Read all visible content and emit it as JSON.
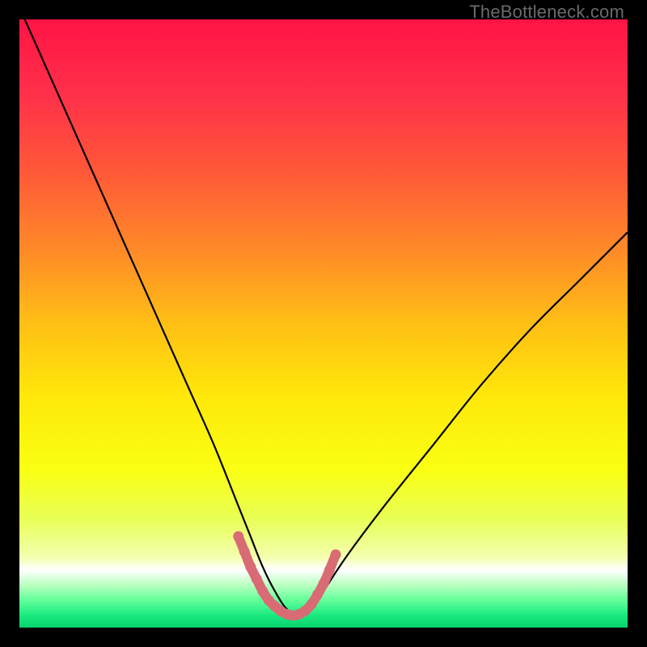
{
  "watermark": "TheBottleneck.com",
  "chart_data": {
    "type": "line",
    "title": "",
    "xlabel": "",
    "ylabel": "",
    "xlim": [
      0,
      100
    ],
    "ylim": [
      0,
      100
    ],
    "grid": false,
    "legend": false,
    "series": [
      {
        "name": "curve",
        "x": [
          0,
          4,
          8,
          12,
          16,
          20,
          24,
          28,
          32,
          36,
          38,
          40,
          42,
          44,
          46,
          48,
          50,
          54,
          60,
          68,
          76,
          84,
          92,
          100
        ],
        "y": [
          102,
          93,
          84,
          75,
          66,
          57,
          48,
          39,
          30,
          20,
          15,
          10,
          6,
          3,
          2,
          3,
          6,
          12,
          20,
          30,
          40,
          49,
          57,
          65
        ]
      },
      {
        "name": "highlight",
        "x": [
          36,
          37,
          38,
          39,
          40,
          41,
          42,
          43,
          44,
          45,
          46,
          47,
          48,
          49,
          50,
          51,
          52
        ],
        "y": [
          15.0,
          12.5,
          10.0,
          8.0,
          6.0,
          4.5,
          3.5,
          2.7,
          2.2,
          2.0,
          2.2,
          2.8,
          3.8,
          5.4,
          7.2,
          9.5,
          12.0
        ]
      }
    ],
    "background_gradient": {
      "stops": [
        {
          "pos": 0.0,
          "color": "#ff1444"
        },
        {
          "pos": 0.12,
          "color": "#ff2f4a"
        },
        {
          "pos": 0.25,
          "color": "#ff5838"
        },
        {
          "pos": 0.38,
          "color": "#ff8a28"
        },
        {
          "pos": 0.5,
          "color": "#ffbf15"
        },
        {
          "pos": 0.62,
          "color": "#ffe80a"
        },
        {
          "pos": 0.74,
          "color": "#faff13"
        },
        {
          "pos": 0.82,
          "color": "#e8ff55"
        },
        {
          "pos": 0.885,
          "color": "#f4ffb0"
        },
        {
          "pos": 0.905,
          "color": "#ffffff"
        },
        {
          "pos": 0.93,
          "color": "#b9ffc0"
        },
        {
          "pos": 0.955,
          "color": "#63ff9a"
        },
        {
          "pos": 0.98,
          "color": "#18e97e"
        },
        {
          "pos": 1.0,
          "color": "#08d46e"
        }
      ]
    },
    "highlight_color": "#d96b74"
  }
}
